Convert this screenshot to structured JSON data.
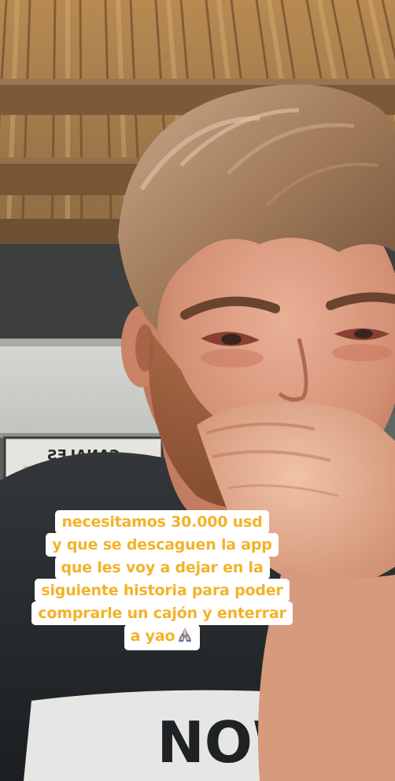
{
  "story": {
    "sign_text": "CANALES",
    "caption_lines": [
      "necesitamos 30.000 usd",
      "y que se descaguen la app",
      "que les voy a dejar en la",
      "siguiente historia para poder",
      "comprarle un cajón y enterrar",
      "a yao"
    ],
    "caption_emoji": "folded-hands-emoji",
    "shirt_print": "NOW"
  },
  "colors": {
    "caption_text": "#f3b229",
    "caption_background": "#ffffff"
  }
}
